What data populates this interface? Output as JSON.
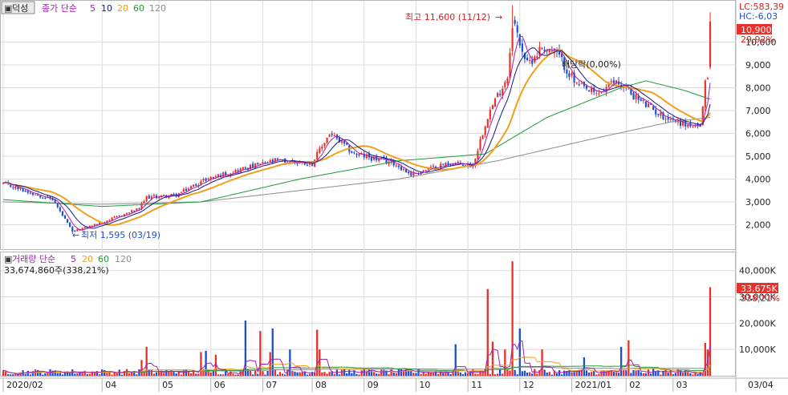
{
  "price_panel": {
    "stock_name": "덕성",
    "legend_prefix": "종가 단순",
    "ma_labels": [
      "5",
      "10",
      "20",
      "60",
      "120"
    ],
    "lc_label": "LC:583,39",
    "hc_label": "HC:-6,03",
    "current_price": "10,900",
    "change_pct": "29,92%",
    "high_annotation": "최고 11,600 (11/12)",
    "low_annotation": "최저 1,595 (03/19)",
    "dividend_annotation": "배당락(0,00%)"
  },
  "volume_panel": {
    "legend_prefix": "거래량 단순",
    "ma_labels": [
      "5",
      "20",
      "60",
      "120"
    ],
    "volume_text": "33,674,860주(338,21%)",
    "current_volume": "33,675K",
    "volume_pct": "338,21%"
  },
  "colors": {
    "up": "#e8312a",
    "down": "#1f4fd1",
    "ma5": "#a31fb4",
    "ma10": "#1a1a80",
    "ma20": "#f0a01e",
    "ma60": "#1f9a3a",
    "ma120": "#8c8c8c",
    "grid": "#dcdcdc",
    "axis_text": "#222222",
    "annotation_red": "#d62020",
    "annotation_blue": "#1f4fd1"
  },
  "chart_data": [
    {
      "type": "candlestick",
      "y_ticks": [
        2000,
        3000,
        4000,
        5000,
        6000,
        7000,
        8000,
        9000,
        10000
      ],
      "y_tick_labels": [
        "2,000",
        "3,000",
        "4,000",
        "5,000",
        "6,000",
        "7,000",
        "8,000",
        "9,000",
        "10,000"
      ],
      "ylim": [
        1000,
        11700
      ],
      "x_labels": [
        "2020/02",
        "04",
        "05",
        "06",
        "07",
        "08",
        "09",
        "10",
        "11",
        "12",
        "2021/01",
        "02",
        "03",
        "03/04"
      ],
      "x_label_days": [
        0,
        40,
        63,
        84,
        105,
        125,
        146,
        167,
        188,
        209,
        230,
        252,
        271,
        289
      ],
      "key_prices": [
        {
          "day": 0,
          "price": 3800
        },
        {
          "day": 20,
          "price": 3100
        },
        {
          "day": 28,
          "price": 1700
        },
        {
          "day": 40,
          "price": 2100
        },
        {
          "day": 55,
          "price": 2700
        },
        {
          "day": 58,
          "price": 3200
        },
        {
          "day": 70,
          "price": 3300
        },
        {
          "day": 82,
          "price": 4000
        },
        {
          "day": 95,
          "price": 4400
        },
        {
          "day": 110,
          "price": 4800
        },
        {
          "day": 125,
          "price": 4700
        },
        {
          "day": 132,
          "price": 6000
        },
        {
          "day": 142,
          "price": 5100
        },
        {
          "day": 158,
          "price": 4700
        },
        {
          "day": 165,
          "price": 4200
        },
        {
          "day": 180,
          "price": 4700
        },
        {
          "day": 190,
          "price": 4600
        },
        {
          "day": 196,
          "price": 6800
        },
        {
          "day": 204,
          "price": 8500
        },
        {
          "day": 206,
          "price": 11000
        },
        {
          "day": 212,
          "price": 9000
        },
        {
          "day": 218,
          "price": 9800
        },
        {
          "day": 224,
          "price": 9500
        },
        {
          "day": 232,
          "price": 8100
        },
        {
          "day": 240,
          "price": 7700
        },
        {
          "day": 248,
          "price": 8300
        },
        {
          "day": 258,
          "price": 7400
        },
        {
          "day": 266,
          "price": 6800
        },
        {
          "day": 276,
          "price": 6400
        },
        {
          "day": 282,
          "price": 6200
        },
        {
          "day": 284,
          "price": 8300
        },
        {
          "day": 285,
          "price": 8400
        },
        {
          "day": 286,
          "price": 10900
        }
      ],
      "ma120_points": [
        {
          "day": 0,
          "price": 3000
        },
        {
          "day": 40,
          "price": 2900
        },
        {
          "day": 80,
          "price": 3000
        },
        {
          "day": 120,
          "price": 3500
        },
        {
          "day": 160,
          "price": 4000
        },
        {
          "day": 200,
          "price": 4800
        },
        {
          "day": 240,
          "price": 5800
        },
        {
          "day": 270,
          "price": 6500
        },
        {
          "day": 286,
          "price": 6700
        }
      ],
      "ma60_points": [
        {
          "day": 0,
          "price": 3100
        },
        {
          "day": 40,
          "price": 2800
        },
        {
          "day": 80,
          "price": 3000
        },
        {
          "day": 120,
          "price": 4000
        },
        {
          "day": 160,
          "price": 4800
        },
        {
          "day": 195,
          "price": 5100
        },
        {
          "day": 220,
          "price": 6700
        },
        {
          "day": 250,
          "price": 8000
        },
        {
          "day": 260,
          "price": 8300
        },
        {
          "day": 275,
          "price": 7900
        },
        {
          "day": 286,
          "price": 7500
        }
      ]
    },
    {
      "type": "bar",
      "name": "volume",
      "y_ticks": [
        10000,
        20000,
        30000,
        40000
      ],
      "y_tick_labels": [
        "10,000K",
        "20,000K",
        "30,000K",
        "40,000K"
      ],
      "ylim": [
        0,
        46000
      ],
      "spikes": [
        {
          "day": 58,
          "volume": 11000
        },
        {
          "day": 56,
          "volume": 6000
        },
        {
          "day": 80,
          "volume": 9000
        },
        {
          "day": 82,
          "volume": 9500
        },
        {
          "day": 86,
          "volume": 8000
        },
        {
          "day": 98,
          "volume": 21000
        },
        {
          "day": 104,
          "volume": 17000
        },
        {
          "day": 108,
          "volume": 9000
        },
        {
          "day": 109,
          "volume": 18000
        },
        {
          "day": 116,
          "volume": 10000
        },
        {
          "day": 127,
          "volume": 17500
        },
        {
          "day": 128,
          "volume": 10000
        },
        {
          "day": 183,
          "volume": 12000
        },
        {
          "day": 196,
          "volume": 33000
        },
        {
          "day": 198,
          "volume": 13000
        },
        {
          "day": 203,
          "volume": 10000
        },
        {
          "day": 206,
          "volume": 43500
        },
        {
          "day": 209,
          "volume": 18000
        },
        {
          "day": 218,
          "volume": 10000
        },
        {
          "day": 235,
          "volume": 7000
        },
        {
          "day": 250,
          "volume": 11000
        },
        {
          "day": 253,
          "volume": 13500
        },
        {
          "day": 284,
          "volume": 12500
        },
        {
          "day": 285,
          "volume": 10000
        },
        {
          "day": 286,
          "volume": 33675
        }
      ]
    }
  ]
}
